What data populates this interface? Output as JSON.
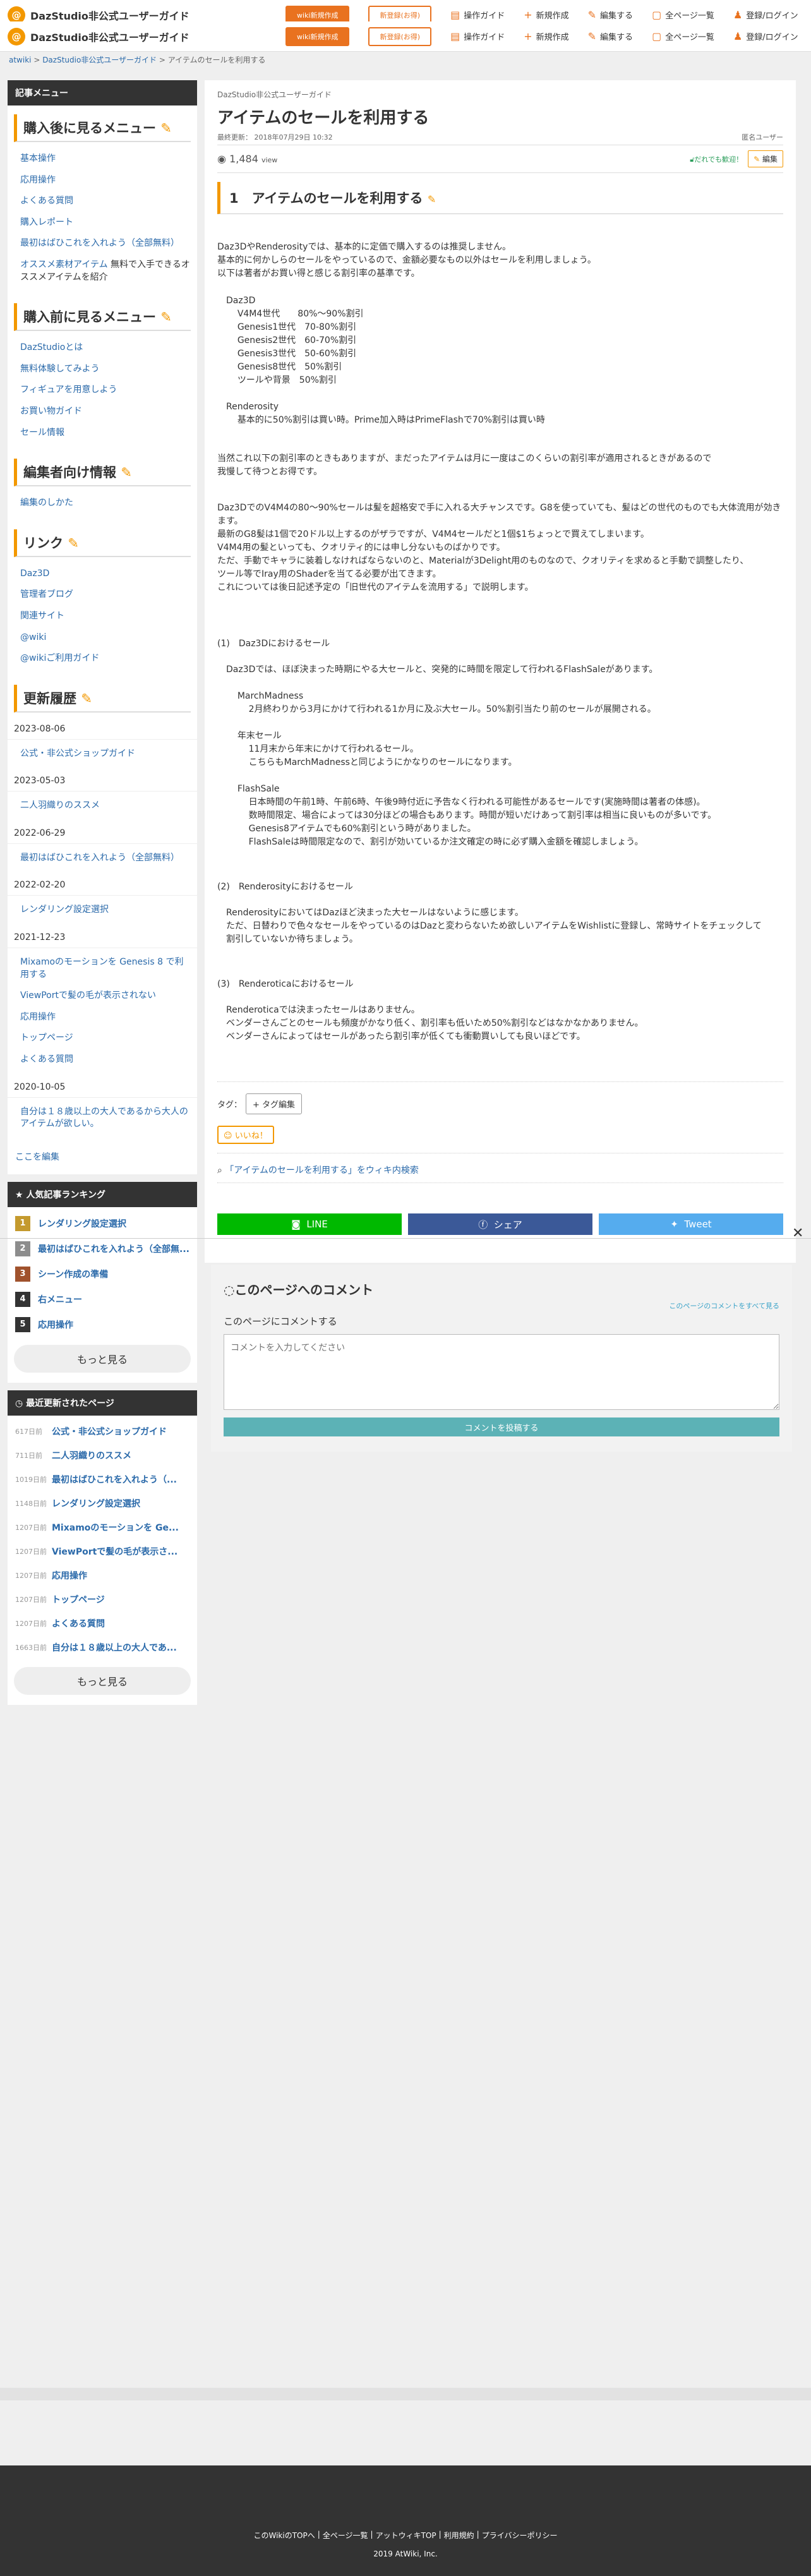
{
  "site": {
    "title": "DazStudio非公式ユーザーガイド",
    "logo": "@",
    "wiki_btn": "wiki新規作成",
    "paid_btn": "新登録(お得)"
  },
  "top_menu": [
    {
      "icon": "book-icon",
      "label": "操作ガイド"
    },
    {
      "icon": "plus-icon",
      "label": "新規作成"
    },
    {
      "icon": "pencil-icon",
      "label": "編集する"
    },
    {
      "icon": "page-icon",
      "label": "全ページ一覧"
    },
    {
      "icon": "users-icon",
      "label": "登録/ログイン"
    }
  ],
  "breadcrumb": {
    "home": "atwiki",
    "sep": " > ",
    "site": "DazStudio非公式ユーザーガイド",
    "page": "アイテムのセールを利用する"
  },
  "sidebar": {
    "title": "記事メニュー",
    "after_purchase": {
      "title": "購入後に見るメニュー",
      "items": [
        "基本操作",
        "応用操作",
        "よくある質問",
        "購入レポート",
        "最初はばひこれを入れよう（全部無料）",
        "オススメ素材アイテム"
      ],
      "suffix": " 無料で入手できるオススメアイテムを紹介"
    },
    "before_purchase": {
      "title": "購入前に見るメニュー",
      "items": [
        "DazStudioとは",
        "無料体験してみよう",
        "フィギュアを用意しよう",
        "お買い物ガイド",
        "セール情報"
      ]
    },
    "editor": {
      "title": "編集者向け情報",
      "items": [
        "編集のしかた"
      ]
    },
    "links": {
      "title": "リンク",
      "items": [
        "Daz3D",
        "管理者ブログ",
        "関連サイト",
        "@wiki",
        "@wikiご利用ガイド"
      ]
    },
    "history": {
      "title": "更新履歴",
      "groups": [
        {
          "date": "2023-08-06",
          "items": [
            "公式・非公式ショップガイド"
          ]
        },
        {
          "date": "2023-05-03",
          "items": [
            "二人羽織りのススメ"
          ]
        },
        {
          "date": "2022-06-29",
          "items": [
            "最初はばひこれを入れよう（全部無料）"
          ]
        },
        {
          "date": "2022-02-20",
          "items": [
            "レンダリング設定選択"
          ]
        },
        {
          "date": "2021-12-23",
          "items": [
            "Mixamoのモーションを Genesis 8 で利用する",
            "ViewPortで髪の毛が表示されない",
            "応用操作",
            "トップページ",
            "よくある質問"
          ]
        },
        {
          "date": "2020-10-05",
          "items": [
            "自分は１８歳以上の大人であるから大人のアイテムが欲しい。"
          ]
        }
      ],
      "edit": "ここを編集"
    },
    "ranking": {
      "title": "人気記事ランキング",
      "items": [
        "レンダリング設定選択",
        "最初はばひこれを入れよう（全部無...",
        "シーン作成の準備",
        "右メニュー",
        "応用操作"
      ],
      "colors": [
        "#c49a2e",
        "#8d8d8d",
        "#a0522d",
        "#333333",
        "#333333"
      ],
      "more": "もっと見る"
    },
    "recent": {
      "title": "最近更新されたページ",
      "items": [
        {
          "ago": "617日前",
          "title": "公式・非公式ショップガイド"
        },
        {
          "ago": "711日前",
          "title": "二人羽織りのススメ"
        },
        {
          "ago": "1019日前",
          "title": "最初はばひこれを入れよう（..."
        },
        {
          "ago": "1148日前",
          "title": "レンダリング設定選択"
        },
        {
          "ago": "1207日前",
          "title": "Mixamoのモーションを Ge..."
        },
        {
          "ago": "1207日前",
          "title": "ViewPortで髪の毛が表示さ..."
        },
        {
          "ago": "1207日前",
          "title": "応用操作"
        },
        {
          "ago": "1207日前",
          "title": "トップページ"
        },
        {
          "ago": "1207日前",
          "title": "よくある質問"
        },
        {
          "ago": "1663日前",
          "title": "自分は１８歳以上の大人であ..."
        }
      ],
      "more": "もっと見る"
    }
  },
  "page": {
    "category": "DazStudio非公式ユーザーガイド",
    "title": "アイテムのセールを利用する",
    "updated": "最終更新： 2018年07月29日 10:32",
    "author": "匿名ユーザー",
    "views": "1,484",
    "views_unit": "view",
    "auth_edit": "だれでも歓迎！",
    "edit_btn": "編集",
    "section1": "1　アイテムのセールを利用する",
    "body1": "Daz3DやRenderosityでは、基本的に定価で購入するのは推奨しません。\n基本的に何かしらのセールをやっているので、金額必要なもの以外はセールを利用しましょう。\n以下は著者がお買い得と感じる割引率の基準です。",
    "body2": "Daz3D\n    V4M4世代　　80%〜90%割引\n    Genesis1世代　70-80%割引\n    Genesis2世代　60-70%割引\n    Genesis3世代　50-60%割引\n    Genesis8世代　50%割引\n    ツールや背景　50%割引\n\nRenderosity\n    基本的に50%割引は買い時。Prime加入時はPrimeFlashで70%割引は買い時",
    "body3": "当然これ以下の割引率のときもありますが、まだったアイテムは月に一度はこのくらいの割引率が適用されるときがあるので\n我慢して待つとお得です。",
    "body4": "Daz3DでのV4M4の80〜90%セールは髪を超格安で手に入れる大チャンスです。G8を使っていても、髪はどの世代のものでも大体流用が効きます。\n最新のG8髪は1個で20ドル以上するのがザラですが、V4M4セールだと1個$1ちょっとで買えてしまいます。\nV4M4用の髪といっても、クオリティ的には申し分ないものばかりです。\nただ、手動でキャラに装着しなければならないのと、Materialが3Delight用のものなので、クオリティを求めると手動で調整したり、\nツール等でIray用のShaderを当てる必要が出てきます。\nこれについては後日記述予定の「旧世代のアイテムを流用する」で説明します。",
    "sub1": "(1)　Daz3Dにおけるセール",
    "sub1_body": "Daz3Dでは、ほぼ決まった時期にやる大セールと、突発的に時間を限定して行われるFlashSaleがあります。\n\n    MarchMadness\n        2月終わりから3月にかけて行われる1か月に及ぶ大セール。50%割引当たり前のセールが展開される。\n\n    年末セール\n        11月末から年末にかけて行われるセール。\n        こちらもMarchMadnessと同じようにかなりのセールになります。\n\n    FlashSale\n        日本時間の午前1時、午前6時、午後9時付近に予告なく行われる可能性があるセールです(実施時間は著者の体感)。\n        数時間限定、場合によっては30分ほどの場合もあります。時間が短いだけあって割引率は相当に良いものが多いです。\n        Genesis8アイテムでも60%割引という時がありました。\n        FlashSaleは時間限定なので、割引が効いているか注文確定の時に必ず購入金額を確認しましょう。",
    "sub2": "(2)　Renderosityにおけるセール",
    "sub2_body": "RenderosityにおいてはDazほど決まった大セールはないように感じます。\nただ、日替わりで色々なセールをやっているのはDazと変わらないため欲しいアイテムをWishlistに登録し、常時サイトをチェックして\n割引していないか待ちましょう。",
    "sub3": "(3)　Renderoticaにおけるセール",
    "sub3_body": "Renderoticaでは決まったセールはありません。\nベンダーさんごとのセールも頻度がかなり低く、割引率も低いため50%割引などはなかなかありません。\nベンダーさんによってはセールがあったら割引率が低くても衝動買いしても良いほどです。",
    "tag_label": "タグ：",
    "tag_btn": "+ タグ編集",
    "like": "いいね！",
    "wiki_search": "「アイテムのセールを利用する」をウィキ内検索",
    "share": [
      {
        "label": "LINE",
        "color": "#00b900"
      },
      {
        "label": "シェア",
        "color": "#3b5998"
      },
      {
        "label": "Tweet",
        "color": "#55acee"
      }
    ]
  },
  "comments": {
    "title": "このページへのコメント",
    "all": "このページのコメントをすべて見る",
    "label": "このページにコメントする",
    "placeholder": "コメントを入力してください",
    "submit": "コメントを投稿する"
  },
  "footer": {
    "links": [
      "このWikiのTOPへ",
      "全ページ一覧",
      "アットウィキTOP",
      "利用規約",
      "プライバシーポリシー"
    ],
    "copyright": "2019 AtWiki, Inc."
  }
}
